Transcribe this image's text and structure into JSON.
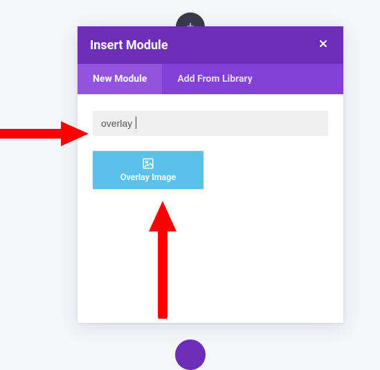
{
  "addCircle": {
    "icon": "plus-icon"
  },
  "header": {
    "title": "Insert Module",
    "closeIcon": "close-icon"
  },
  "tabs": [
    {
      "label": "New Module",
      "active": true
    },
    {
      "label": "Add From Library",
      "active": false
    }
  ],
  "search": {
    "value": "overlay",
    "placeholder": ""
  },
  "modules": [
    {
      "icon": "overlay-image-icon",
      "label": "Overlay Image"
    }
  ],
  "annotationColor": "#ff0000"
}
